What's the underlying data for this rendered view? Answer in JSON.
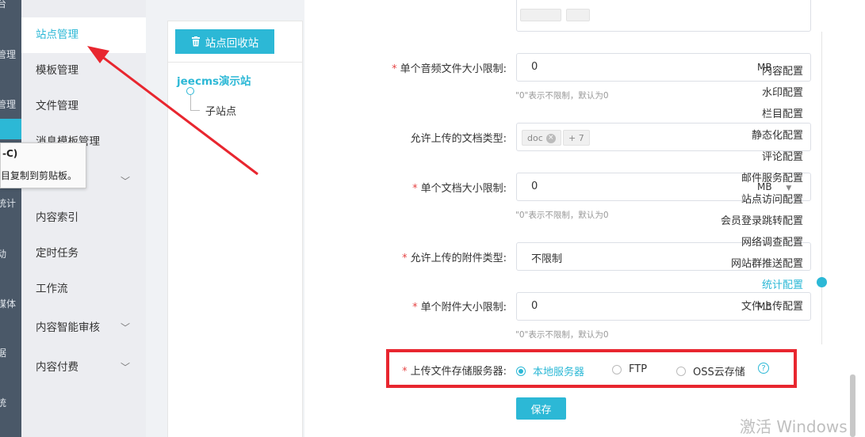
{
  "rail": {
    "labels": [
      "台",
      "管理",
      "管理",
      "统计",
      "动",
      "媒体",
      "据",
      "统"
    ]
  },
  "tooltip": {
    "shortcut": "-C)",
    "text": "目复制到剪贴板。"
  },
  "submenu": {
    "items": [
      {
        "label": "站点管理",
        "active": true
      },
      {
        "label": "模板管理"
      },
      {
        "label": "文件管理"
      },
      {
        "label": "消息模板管理"
      },
      {
        "label": "内容索引"
      },
      {
        "label": "定时任务"
      },
      {
        "label": "工作流"
      },
      {
        "label": "内容智能审核"
      },
      {
        "label": "内容付费"
      }
    ]
  },
  "tree": {
    "recycle_label": "站点回收站",
    "root": "jeecms演示站",
    "child": "子站点"
  },
  "form": {
    "audio_size_label": "单个音频文件大小限制:",
    "audio_size_value": "0",
    "audio_unit": "MB",
    "audio_hint": "\"0\"表示不限制，默认为0",
    "doc_types_label": "允许上传的文档类型:",
    "doc_tag": "doc",
    "doc_more": "+ 7",
    "doc_size_label": "单个文档大小限制:",
    "doc_size_value": "0",
    "doc_unit": "MB",
    "doc_hint": "\"0\"表示不限制，默认为0",
    "attach_types_label": "允许上传的附件类型:",
    "attach_types_value": "不限制",
    "attach_size_label": "单个附件大小限制:",
    "attach_size_value": "0",
    "attach_unit": "MB",
    "attach_hint": "\"0\"表示不限制，默认为0",
    "storage_label": "上传文件存储服务器:",
    "storage_options": [
      "本地服务器",
      "FTP",
      "OSS云存储"
    ],
    "storage_selected": "本地服务器",
    "save_label": "保存"
  },
  "anchor_menu": [
    {
      "label": "内容配置"
    },
    {
      "label": "水印配置"
    },
    {
      "label": "栏目配置"
    },
    {
      "label": "静态化配置"
    },
    {
      "label": "评论配置"
    },
    {
      "label": "邮件服务配置"
    },
    {
      "label": "站点访问配置"
    },
    {
      "label": "会员登录跳转配置"
    },
    {
      "label": "网络调查配置"
    },
    {
      "label": "网站群推送配置"
    },
    {
      "label": "统计配置",
      "active": true
    },
    {
      "label": "文件上传配置"
    }
  ],
  "watermark": "激活 Windows",
  "colors": {
    "accent": "#2cb8d6",
    "highlight_red": "#e8262f",
    "required_star": "#e64545",
    "rail": "#4a5868"
  }
}
